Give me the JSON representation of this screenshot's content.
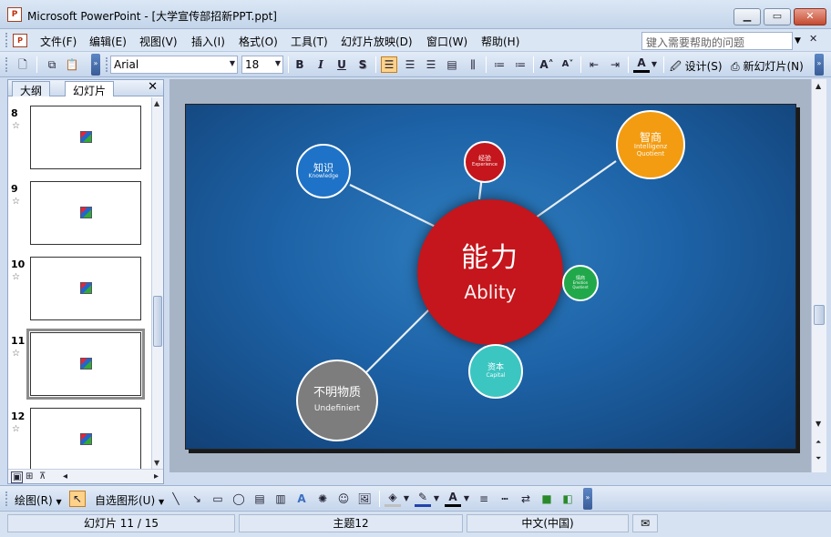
{
  "window": {
    "title": "Microsoft PowerPoint - [大学宣传部招新PPT.ppt]",
    "app_icon": "P",
    "controls": {
      "minimize": "▁",
      "maximize": "▭",
      "close": "✕"
    }
  },
  "menu": {
    "items": [
      "文件(F)",
      "编辑(E)",
      "视图(V)",
      "插入(I)",
      "格式(O)",
      "工具(T)",
      "幻灯片放映(D)",
      "窗口(W)",
      "帮助(H)"
    ],
    "help_placeholder": "键入需要帮助的问题"
  },
  "toolbar": {
    "font": "Arial",
    "size": "18",
    "bold": "B",
    "italic": "I",
    "underline": "U",
    "shadow": "S",
    "design": "设计(S)",
    "new_slide": "新幻灯片(N)",
    "font_color_label": "A"
  },
  "left_pane": {
    "tabs": [
      "大纲",
      "幻灯片"
    ],
    "close": "✕",
    "slides": [
      {
        "num": "8"
      },
      {
        "num": "9"
      },
      {
        "num": "10"
      },
      {
        "num": "11",
        "selected": true
      },
      {
        "num": "12"
      }
    ]
  },
  "slide": {
    "center": {
      "title": "能力",
      "subtitle": "Ablity",
      "color": "#c4161c"
    },
    "bubbles": [
      {
        "id": "knowledge",
        "title": "知识",
        "subtitle": "Knowledge",
        "color": "#1e73c8"
      },
      {
        "id": "experience",
        "title": "经验",
        "subtitle": "Experience",
        "color": "#c4161c"
      },
      {
        "id": "iq",
        "title": "智商",
        "subtitle": "Intelligenz Quotient",
        "color": "#f39c12"
      },
      {
        "id": "eq",
        "title": "情商",
        "subtitle": "Emotion Quotient",
        "color": "#21a84a"
      },
      {
        "id": "capital",
        "title": "资本",
        "subtitle": "Capital",
        "color": "#3cc6c2"
      },
      {
        "id": "undefined",
        "title": "不明物质",
        "subtitle": "Undefiniert",
        "color": "#7d7d7d"
      }
    ]
  },
  "drawbar": {
    "draw": "绘图(R)",
    "autoshapes": "自选图形(U)"
  },
  "status": {
    "slide_pos": "幻灯片 11 / 15",
    "theme": "主题12",
    "language": "中文(中国)"
  }
}
